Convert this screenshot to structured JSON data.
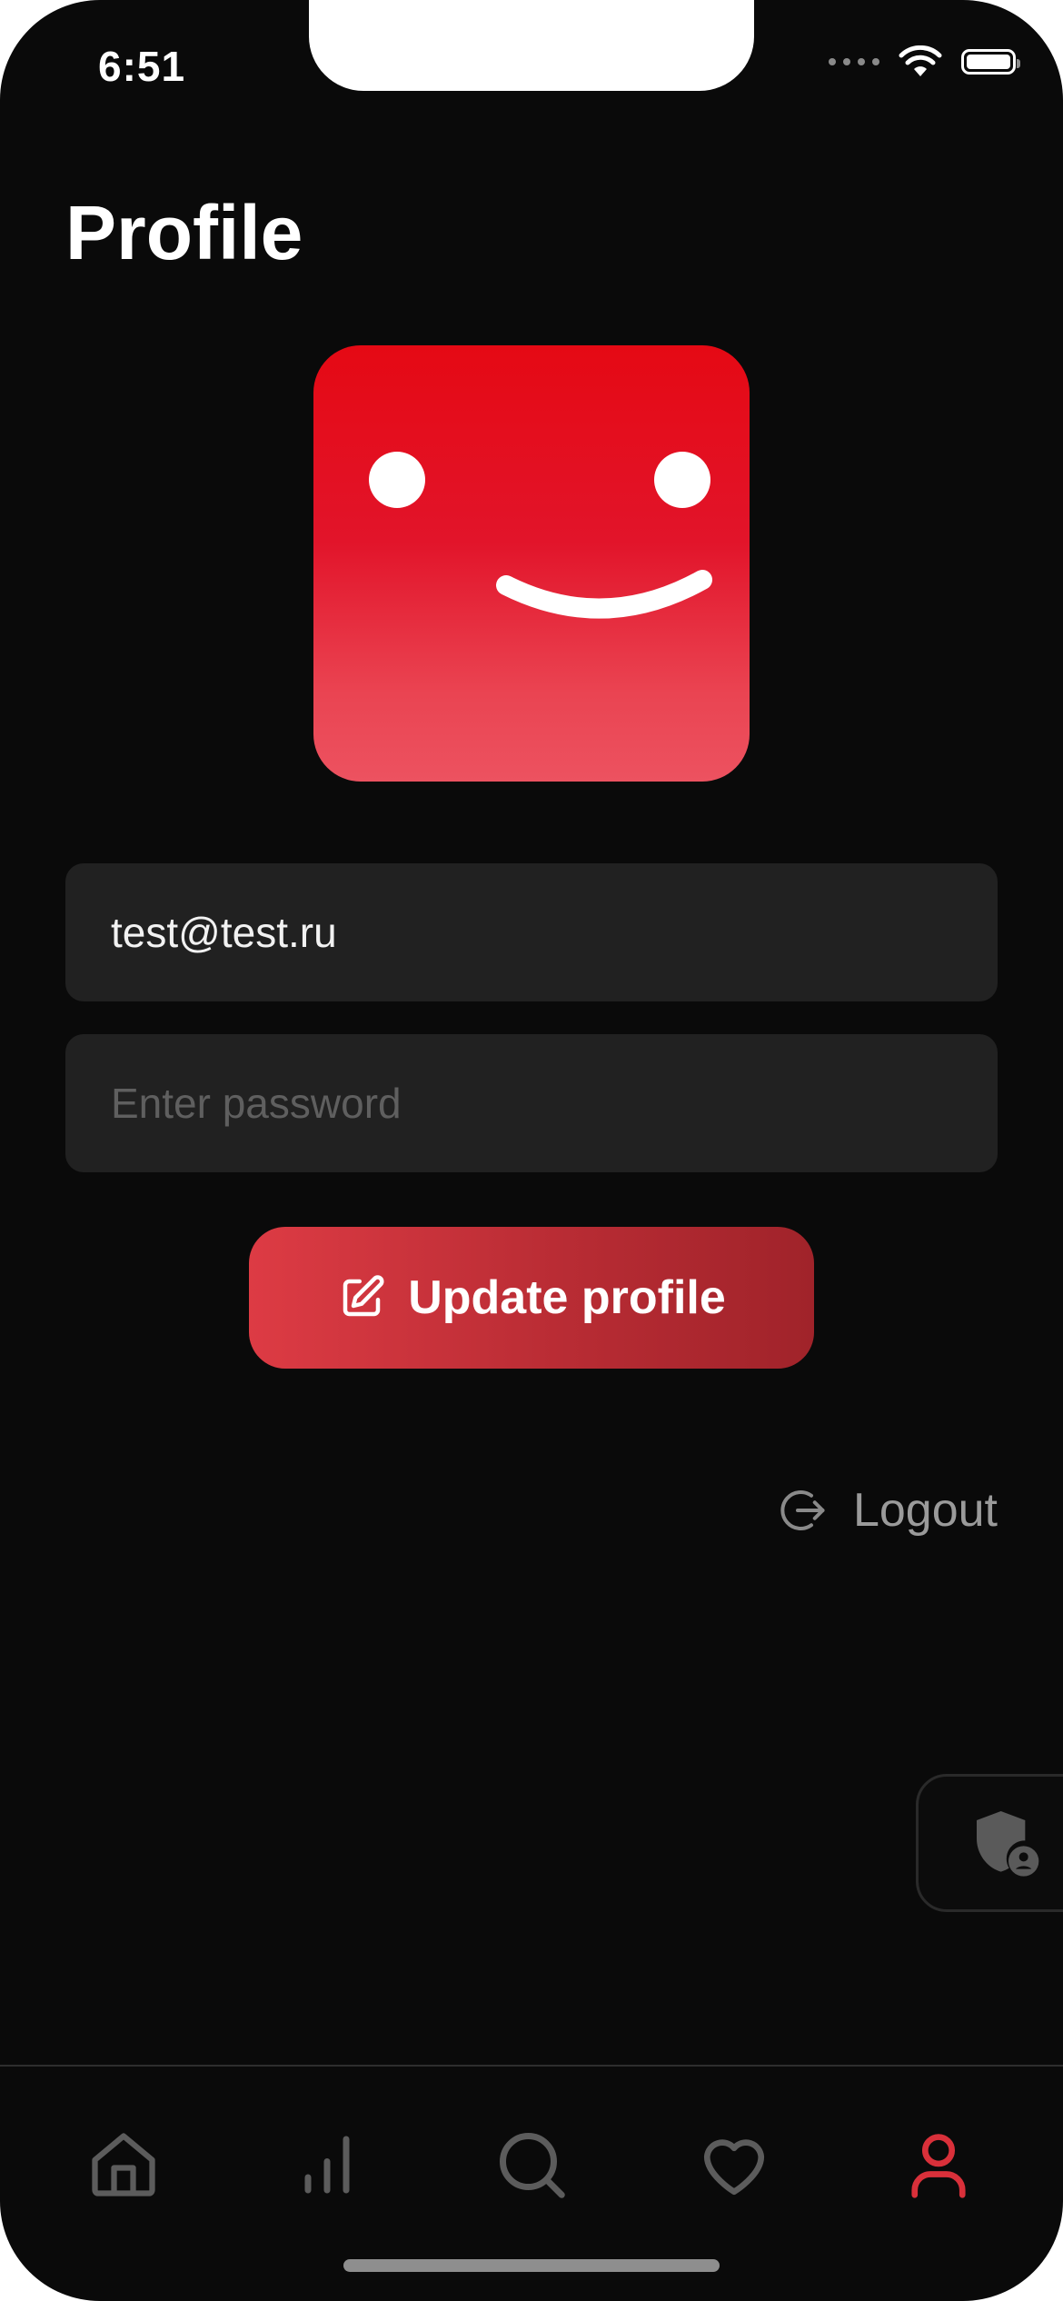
{
  "status_bar": {
    "time": "6:51"
  },
  "header": {
    "title": "Profile"
  },
  "form": {
    "email_value": "test@test.ru",
    "password_placeholder": "Enter password",
    "update_label": "Update profile"
  },
  "logout_label": "Logout",
  "tabbar": {
    "items": [
      {
        "icon": "home-icon",
        "active": false
      },
      {
        "icon": "bar-chart-icon",
        "active": false
      },
      {
        "icon": "search-icon",
        "active": false
      },
      {
        "icon": "heart-icon",
        "active": false
      },
      {
        "icon": "user-icon",
        "active": true
      }
    ]
  },
  "colors": {
    "background": "#0a0a0a",
    "accent": "#e50914",
    "input_bg": "#212121",
    "muted": "#9a9a9a",
    "tab_inactive": "#5c5c5c",
    "tab_active": "#d9303a"
  }
}
